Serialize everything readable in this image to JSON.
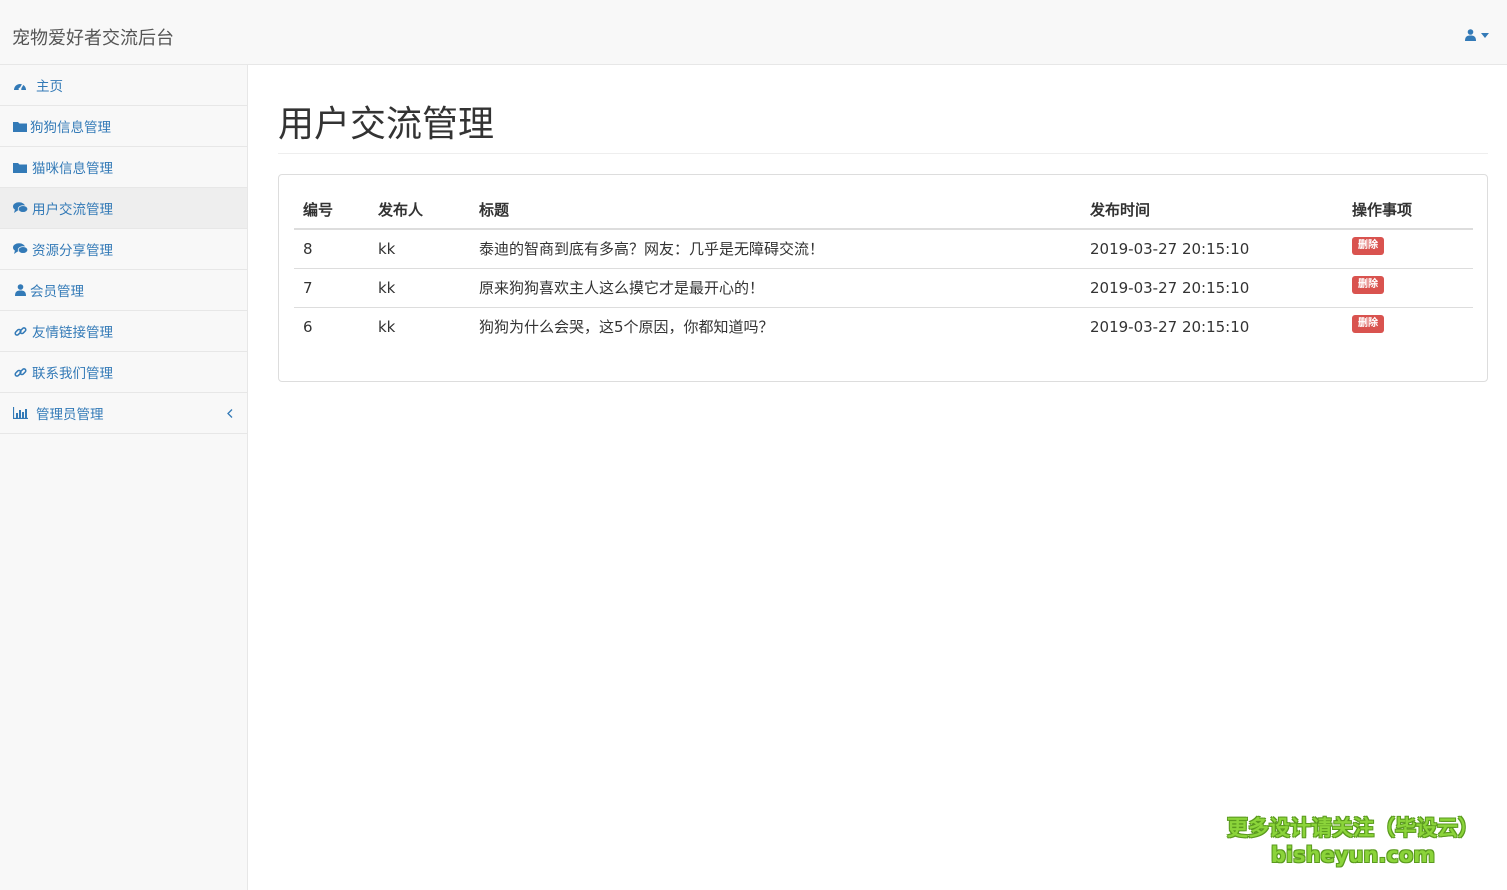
{
  "header": {
    "brand": "宠物爱好者交流后台"
  },
  "sidebar": {
    "items": [
      {
        "label": "主页",
        "icon": "dashboard-icon"
      },
      {
        "label": "狗狗信息管理",
        "icon": "folder-icon"
      },
      {
        "label": "猫咪信息管理",
        "icon": "folder-icon"
      },
      {
        "label": "用户交流管理",
        "icon": "comments-icon"
      },
      {
        "label": "资源分享管理",
        "icon": "comments-icon"
      },
      {
        "label": "会员管理",
        "icon": "user-icon"
      },
      {
        "label": "友情链接管理",
        "icon": "link-icon"
      },
      {
        "label": "联系我们管理",
        "icon": "link-icon"
      },
      {
        "label": "管理员管理",
        "icon": "bar-chart-icon"
      }
    ],
    "active_index": 3
  },
  "main": {
    "title": "用户交流管理",
    "table": {
      "columns": [
        "编号",
        "发布人",
        "标题",
        "发布时间",
        "操作事项"
      ],
      "rows": [
        {
          "id": "8",
          "author": "kk",
          "title": "泰迪的智商到底有多高？网友：几乎是无障碍交流！",
          "time": "2019-03-27 20:15:10",
          "action": "删除"
        },
        {
          "id": "7",
          "author": "kk",
          "title": "原来狗狗喜欢主人这么摸它才是最开心的！",
          "time": "2019-03-27 20:15:10",
          "action": "删除"
        },
        {
          "id": "6",
          "author": "kk",
          "title": "狗狗为什么会哭，这5个原因，你都知道吗？",
          "time": "2019-03-27 20:15:10",
          "action": "删除"
        }
      ]
    }
  },
  "watermark": {
    "line1": "更多设计请关注（毕设云）",
    "line2": "bisheyun.com"
  },
  "colors": {
    "link": "#337ab7",
    "danger": "#d9534f",
    "watermark": "#8bd43a"
  }
}
